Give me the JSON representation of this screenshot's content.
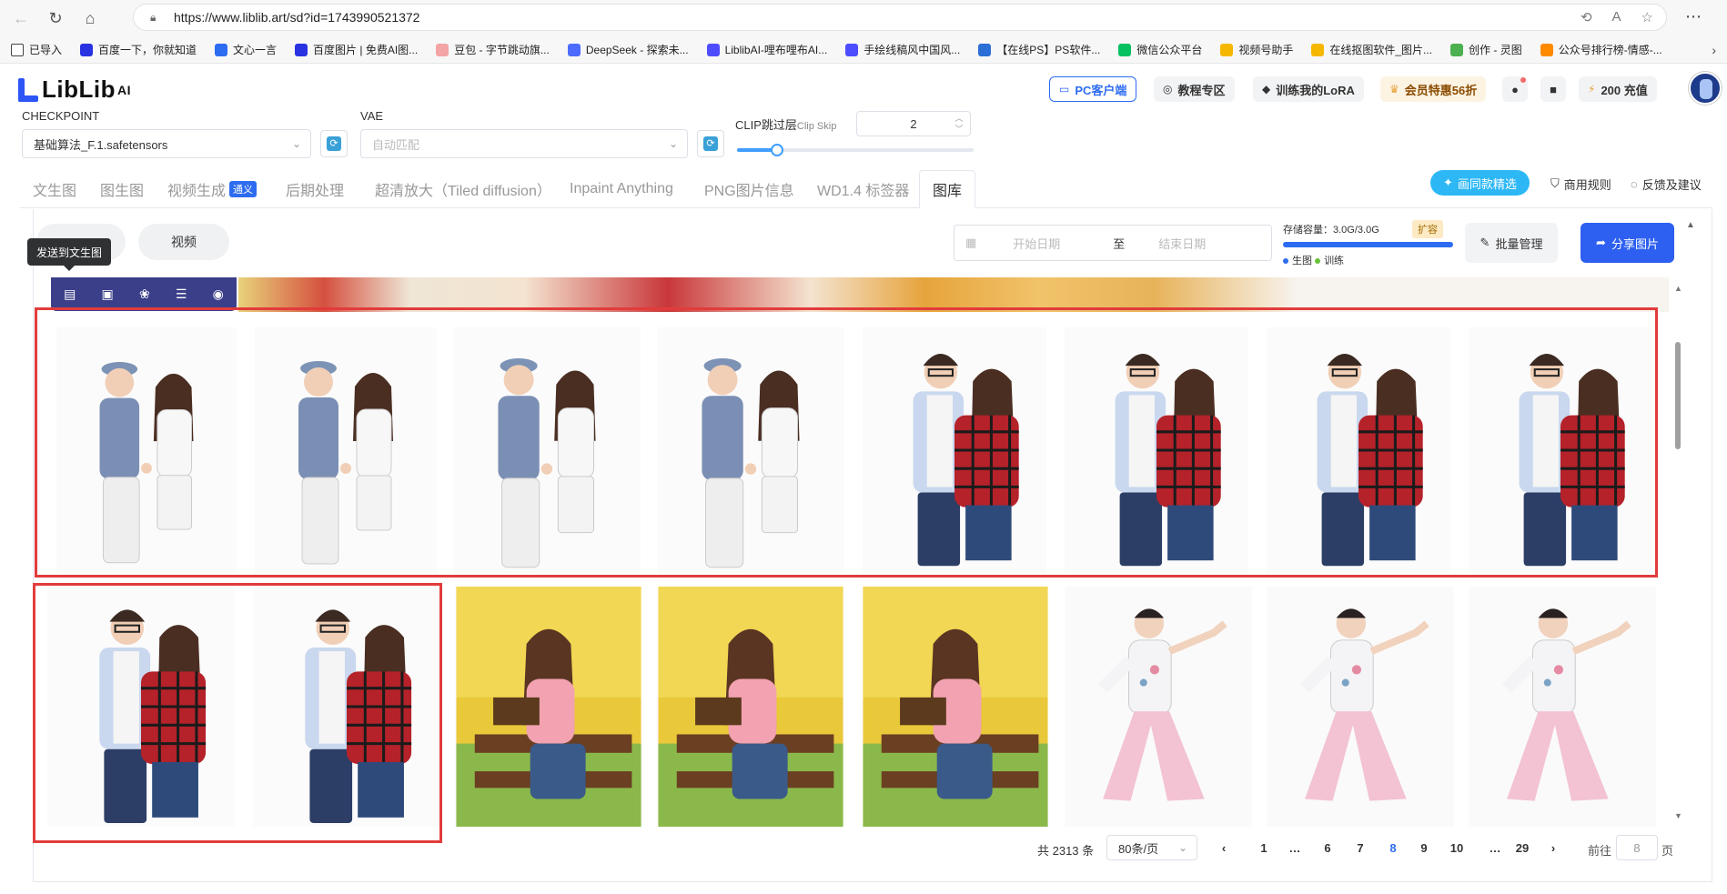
{
  "browser": {
    "url": "https://www.liblib.art/sd?id=1743990521372"
  },
  "bookmarks": [
    {
      "label": "已导入",
      "color": "#ffffff"
    },
    {
      "label": "百度一下，你就知道",
      "color": "#2932e1"
    },
    {
      "label": "文心一言",
      "color": "#2d6cf0"
    },
    {
      "label": "百度图片 | 免费AI图...",
      "color": "#2932e1"
    },
    {
      "label": "豆包 - 字节跳动旗...",
      "color": "#f3a4a4"
    },
    {
      "label": "DeepSeek - 探索未...",
      "color": "#4d6bfe"
    },
    {
      "label": "LiblibAI-哩布哩布AI...",
      "color": "#4d4dff"
    },
    {
      "label": "手绘线稿风中国风...",
      "color": "#4d4dff"
    },
    {
      "label": "【在线PS】PS软件...",
      "color": "#2a6ed6"
    },
    {
      "label": "微信公众平台",
      "color": "#07c160"
    },
    {
      "label": "视频号助手",
      "color": "#f6b700"
    },
    {
      "label": "在线抠图软件_图片...",
      "color": "#f6b700"
    },
    {
      "label": "创作 - 灵图",
      "color": "#4caf50"
    },
    {
      "label": "公众号排行榜-情感-...",
      "color": "#ff8a00"
    }
  ],
  "topnav": {
    "logo": "LibLib",
    "logo_sup": "AI",
    "pc_client": "PC客户端",
    "tutorial": "教程专区",
    "train_lora": "训练我的LoRA",
    "member": "会员特惠56折",
    "recharge": "200 充值"
  },
  "controls": {
    "checkpoint_label": "CHECKPOINT",
    "checkpoint_value": "基础算法_F.1.safetensors",
    "vae_label": "VAE",
    "vae_placeholder": "自动匹配",
    "clip_label": "CLIP跳过层",
    "clip_sub": "Clip Skip",
    "clip_value": "2",
    "clip_fraction": 0.17
  },
  "tabs": [
    {
      "label": "文生图"
    },
    {
      "label": "图生图"
    },
    {
      "label": "视频生成",
      "badge": "通义"
    },
    {
      "label": "后期处理"
    },
    {
      "label": "超清放大（Tiled diffusion）"
    },
    {
      "label": "Inpaint Anything"
    },
    {
      "label": "PNG图片信息"
    },
    {
      "label": "WD1.4 标签器"
    },
    {
      "label": "图库",
      "active": true
    }
  ],
  "rightlinks": {
    "same_style": "画同款精选",
    "commercial": "商用规则",
    "feedback": "反馈及建议"
  },
  "gallery": {
    "seg_video": "视频",
    "tooltip": "发送到文生图",
    "start_date": "开始日期",
    "to": "至",
    "end_date": "结束日期",
    "storage_label": "存储容量：3.0G/3.0G",
    "storage_fraction": 1.0,
    "expand": "扩容",
    "legend_gen": "生图",
    "legend_train": "训练",
    "batch": "批量管理",
    "share": "分享图片"
  },
  "pagination": {
    "total": "共 2313 条",
    "per_page": "80条/页",
    "pages": [
      "1",
      "…",
      "6",
      "7",
      "8",
      "9",
      "10",
      "…",
      "29"
    ],
    "current": "8",
    "goto_label": "前往",
    "goto_value": "8",
    "page_suffix": "页"
  }
}
